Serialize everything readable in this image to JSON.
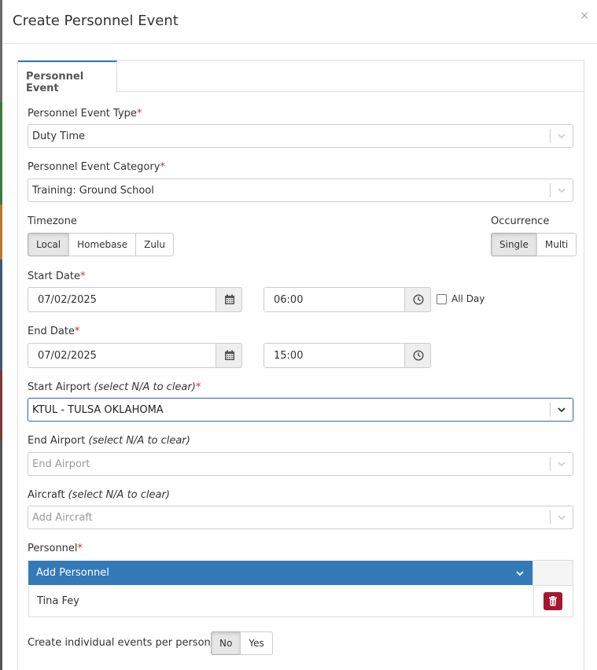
{
  "modal": {
    "title": "Create Personnel Event",
    "close": "×"
  },
  "tabs": [
    {
      "label": "Personnel Event"
    }
  ],
  "event_type": {
    "label": "Personnel Event Type",
    "required": "*",
    "value": "Duty Time"
  },
  "event_category": {
    "label": "Personnel Event Category",
    "required": "*",
    "value": "Training: Ground School"
  },
  "timezone": {
    "label": "Timezone",
    "options": [
      "Local",
      "Homebase",
      "Zulu"
    ],
    "selected": "Local"
  },
  "occurrence": {
    "label": "Occurrence",
    "options": [
      "Single",
      "Multi"
    ],
    "selected": "Single"
  },
  "start_date": {
    "label": "Start Date",
    "required": "*",
    "date": "07/02/2025",
    "time": "06:00",
    "all_day_label": "All Day"
  },
  "end_date": {
    "label": "End Date",
    "required": "*",
    "date": "07/02/2025",
    "time": "15:00"
  },
  "start_airport": {
    "label": "Start Airport",
    "hint": "(select N/A to clear)",
    "required": "*",
    "value": "KTUL - TULSA OKLAHOMA"
  },
  "end_airport": {
    "label": "End Airport",
    "hint": "(select N/A to clear)",
    "placeholder": "End Airport"
  },
  "aircraft": {
    "label": "Aircraft",
    "hint": "(select N/A to clear)",
    "placeholder": "Add Aircraft"
  },
  "personnel": {
    "label": "Personnel",
    "required": "*",
    "add_label": "Add Personnel",
    "rows": [
      {
        "name": "Tina Fey"
      }
    ]
  },
  "individual_events": {
    "label": "Create individual events per personnel",
    "options": [
      "No",
      "Yes"
    ],
    "selected": "No"
  },
  "colors": {
    "accent": "#337ab7",
    "required": "#c9302c",
    "danger": "#a5172e"
  }
}
